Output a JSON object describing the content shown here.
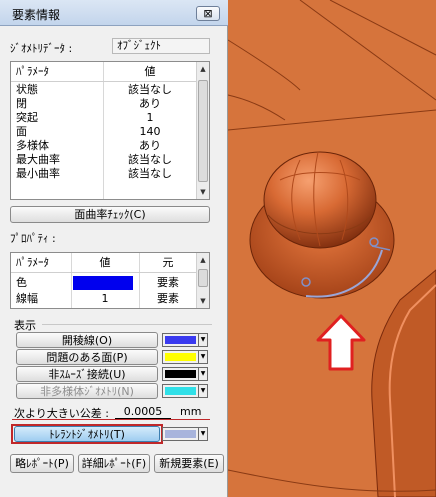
{
  "dialog": {
    "title": "要素情報",
    "close_glyph": "⊠",
    "geometry_label": "ｼﾞｵﾒﾄﾘﾃﾞｰﾀ :",
    "geometry_value": "ｵﾌﾞｼﾞｪｸﾄ"
  },
  "params_table": {
    "headers": [
      "ﾊﾟﾗﾒｰﾀ",
      "値"
    ],
    "rows": [
      {
        "name": "状態",
        "value": "該当なし"
      },
      {
        "name": "閉",
        "value": "あり"
      },
      {
        "name": "突起",
        "value": "1"
      },
      {
        "name": "面",
        "value": "140"
      },
      {
        "name": "多様体",
        "value": "あり"
      },
      {
        "name": "最大曲率",
        "value": "該当なし"
      },
      {
        "name": "最小曲率",
        "value": "該当なし"
      }
    ]
  },
  "curvature_check_label": "面曲率ﾁｪｯｸ(C)",
  "property_label": "ﾌﾟﾛﾊﾟﾃｨ :",
  "props_table": {
    "headers": [
      "ﾊﾟﾗﾒｰﾀ",
      "値",
      "元"
    ],
    "rows": [
      {
        "name": "色",
        "value": "",
        "source": "要素",
        "swatch": "#0000ee"
      },
      {
        "name": "線幅",
        "value": "1",
        "source": "要素"
      }
    ]
  },
  "display": {
    "label": "表示",
    "items": [
      {
        "label": "開稜線(O)",
        "color": "#3a3af0",
        "enabled": true
      },
      {
        "label": "問題のある面(P)",
        "color": "#ffff00",
        "enabled": true
      },
      {
        "label": "非ｽﾑｰｽﾞ接続(U)",
        "color": "#000000",
        "enabled": true
      },
      {
        "label": "非多様体ｼﾞｵﾒﾄﾘ(N)",
        "color": "#30e0e8",
        "enabled": false
      }
    ]
  },
  "tolerance": {
    "label": "次より大きい公差 :",
    "value": "0.0005",
    "unit": "mm"
  },
  "tolerant_geometry": {
    "label": "ﾄﾚﾗﾝﾄｼﾞｵﾒﾄﾘ(T)",
    "color": "#a8b4dc"
  },
  "footer": {
    "brief": "略ﾚﾎﾟｰﾄ(P)",
    "detail": "詳細ﾚﾎﾟｰﾄ(F)",
    "new_element": "新規要素(E)"
  },
  "colors": {
    "model_surface": "#d26a36",
    "highlight_box": "#c0282a",
    "arrow_outline": "#e02020"
  }
}
